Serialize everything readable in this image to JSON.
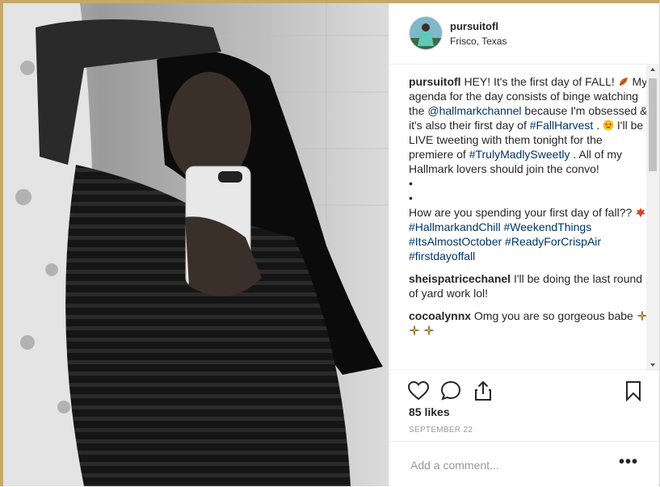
{
  "post": {
    "username": "pursuitofl",
    "location": "Frisco, Texas"
  },
  "caption": {
    "username": "pursuitofl",
    "t1": "HEY! It's the first day of FALL! ",
    "t2": " My agenda for the day consists of binge watching the ",
    "mention": "@hallmarkchannel",
    "t3": " because I'm obsessed & it's also their first day of ",
    "tag1": "#FallHarvest",
    "t4": " . ",
    "t5": " I'll be LIVE tweeting with them tonight for the premiere of ",
    "tag2": "#TrulyMadlySweetly",
    "t6": " . All of my Hallmark lovers should join the convo!",
    "bullet1": "•",
    "bullet2": "•",
    "t7": "How are you spending your first day of fall?? ",
    "tags": [
      "#HallmarkandChill",
      "#WeekendThings",
      "#ItsAlmostOctober",
      "#ReadyForCrispAir",
      "#firstdayoffall"
    ]
  },
  "comments": [
    {
      "username": "sheispatricechanel",
      "text": "I'll be doing the last round of yard work lol!"
    },
    {
      "username": "cocoalynnx",
      "text": "Omg you are so gorgeous babe "
    }
  ],
  "likes": "85 likes",
  "date": "SEPTEMBER 22",
  "add_comment": {
    "placeholder": "Add a comment..."
  },
  "more_label": "•••",
  "icons": [
    "heart-icon",
    "comment-icon",
    "share-icon",
    "bookmark-icon",
    "leaf-emoji",
    "star-eyes-emoji",
    "sparkles-emoji"
  ],
  "colors": {
    "link": "#003569",
    "frame": "#c7a86a",
    "muted": "#999999"
  }
}
